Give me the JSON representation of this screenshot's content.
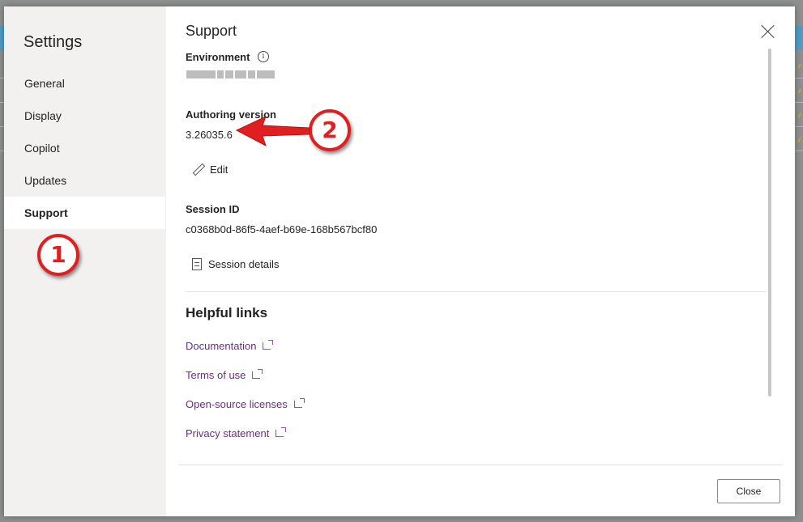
{
  "nav": {
    "title": "Settings",
    "items": [
      {
        "label": "General",
        "active": false
      },
      {
        "label": "Display",
        "active": false
      },
      {
        "label": "Copilot",
        "active": false
      },
      {
        "label": "Updates",
        "active": false
      },
      {
        "label": "Support",
        "active": true
      }
    ]
  },
  "support": {
    "title": "Support",
    "environment_label": "Environment",
    "authoring_label": "Authoring version",
    "authoring_value": "3.26035.6",
    "edit_label": "Edit",
    "session_label": "Session ID",
    "session_value": "c0368b0d-86f5-4aef-b69e-168b567bcf80",
    "session_details_label": "Session details"
  },
  "helpful_links": {
    "title": "Helpful links",
    "links": [
      "Documentation",
      "Terms of use",
      "Open-source licenses",
      "Privacy statement"
    ]
  },
  "footer": {
    "close_label": "Close"
  },
  "callouts": {
    "one": "1",
    "two": "2"
  },
  "icons": {
    "info": "info-icon",
    "edit": "pencil-icon",
    "session_details": "document-icon",
    "external": "external-link-icon",
    "dismiss": "close-icon"
  },
  "colors": {
    "accent_link": "#6b2d86",
    "callout": "#e02020",
    "nav_bg": "#f2f1f0"
  }
}
